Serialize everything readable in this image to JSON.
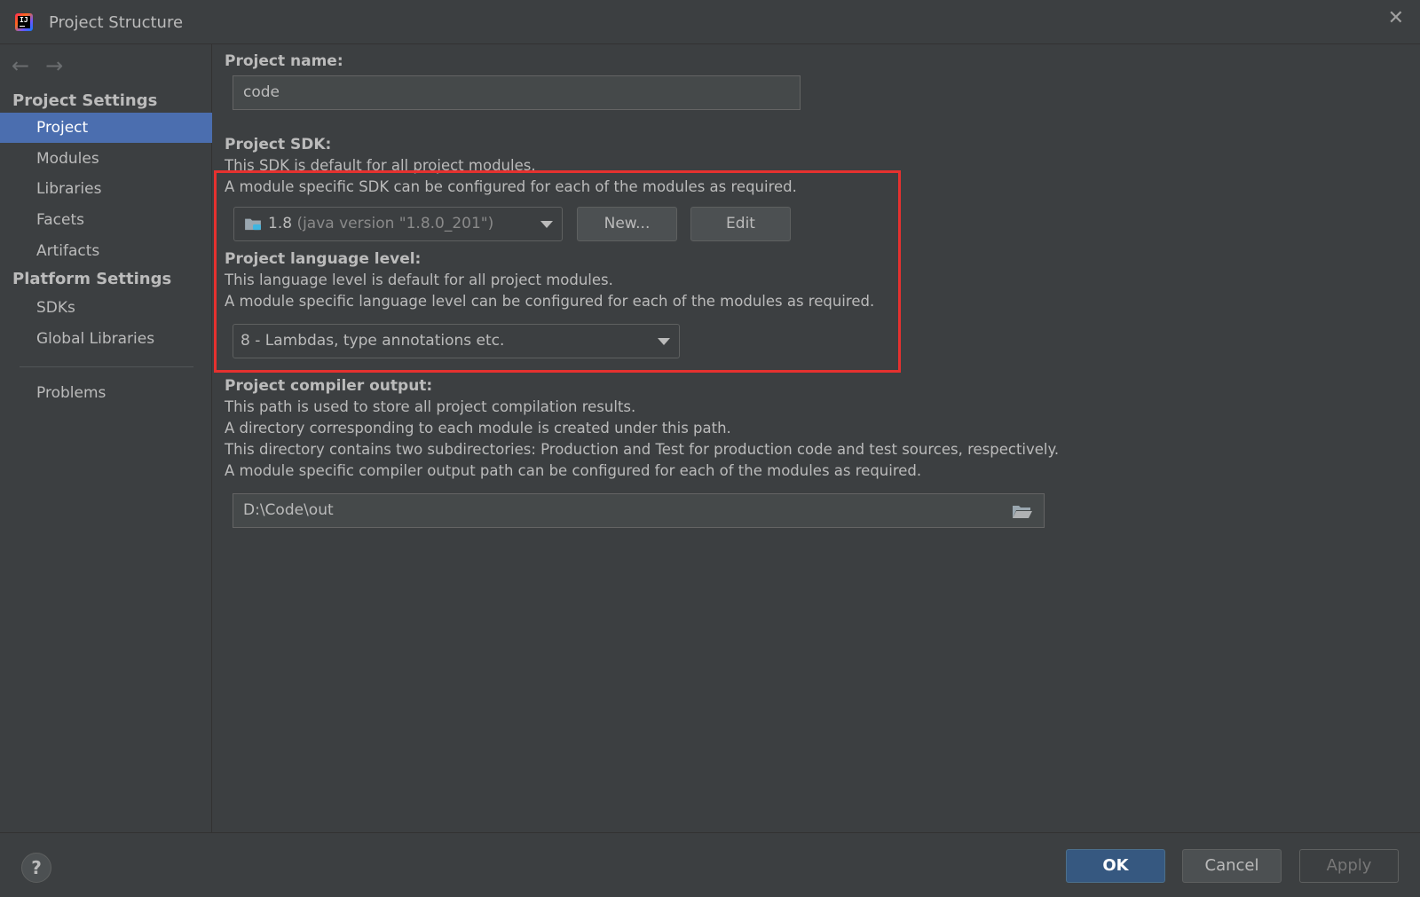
{
  "window": {
    "title": "Project Structure",
    "app_icon": "intellij-idea-icon",
    "close_glyph": "✕"
  },
  "nav": {
    "back_glyph": "←",
    "forward_glyph": "→"
  },
  "sidebar": {
    "project_settings_header": "Project Settings",
    "project_items": [
      {
        "label": "Project",
        "selected": true
      },
      {
        "label": "Modules"
      },
      {
        "label": "Libraries"
      },
      {
        "label": "Facets"
      },
      {
        "label": "Artifacts"
      }
    ],
    "platform_settings_header": "Platform Settings",
    "platform_items": [
      {
        "label": "SDKs"
      },
      {
        "label": "Global Libraries"
      }
    ],
    "problems_label": "Problems"
  },
  "main": {
    "project_name": {
      "label": "Project name:",
      "value": "code"
    },
    "project_sdk": {
      "label": "Project SDK:",
      "desc1": "This SDK is default for all project modules.",
      "desc2": "A module specific SDK can be configured for each of the modules as required.",
      "selected_name": "1.8",
      "selected_detail": "(java version \"1.8.0_201\")",
      "new_button": "New...",
      "edit_button": "Edit"
    },
    "language_level": {
      "label": "Project language level:",
      "desc1": "This language level is default for all project modules.",
      "desc2": "A module specific language level can be configured for each of the modules as required.",
      "selected": "8 - Lambdas, type annotations etc."
    },
    "compiler_output": {
      "label": "Project compiler output:",
      "desc1": "This path is used to store all project compilation results.",
      "desc2": "A directory corresponding to each module is created under this path.",
      "desc3": "This directory contains two subdirectories: Production and Test for production code and test sources, respectively.",
      "desc4": "A module specific compiler output path can be configured for each of the modules as required.",
      "path": "D:\\Code\\out"
    }
  },
  "footer": {
    "help_glyph": "?",
    "ok_button": "OK",
    "cancel_button": "Cancel",
    "apply_button": "Apply"
  },
  "colors": {
    "accent": "#4b6eaf",
    "ok_button": "#365880",
    "highlight_box": "#e5312f",
    "background": "#3c3f41"
  }
}
